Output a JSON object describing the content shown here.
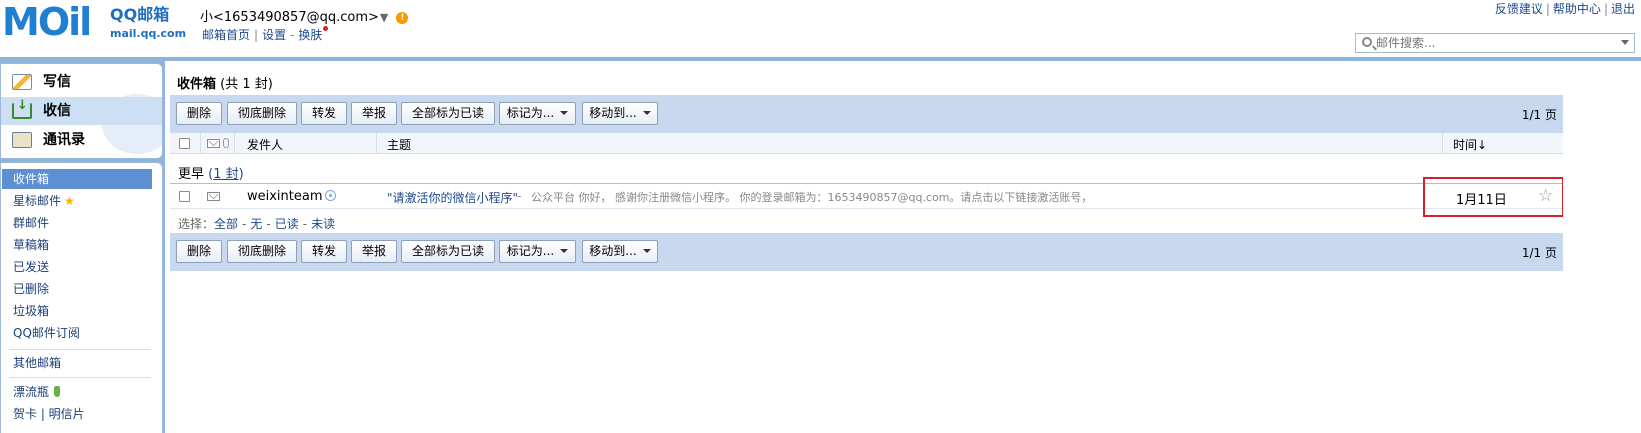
{
  "header": {
    "logo_text_moil": "MOil",
    "logo_text_cn": "QQ邮箱",
    "logo_text_url": "mail.qq.com",
    "account_label": "小<1653490857@qq.com>",
    "account_caret": "▼",
    "warning_glyph": "!",
    "links": [
      "邮箱首页",
      "设置",
      "换肤"
    ],
    "top_links": [
      "反馈建议",
      "帮助中心",
      "退出"
    ],
    "search_placeholder": "邮件搜索..."
  },
  "sidebar": {
    "quick": [
      {
        "label": "写信",
        "icon": "compose-icon"
      },
      {
        "label": "收信",
        "icon": "inbox-icon",
        "active": true
      },
      {
        "label": "通讯录",
        "icon": "contacts-icon"
      }
    ],
    "folders": [
      "收件箱",
      "星标邮件",
      "群邮件",
      "草稿箱",
      "已发送",
      "已删除",
      "垃圾箱",
      "QQ邮件订阅",
      "其他邮箱",
      "漂流瓶",
      "贺卡 | 明信片"
    ],
    "star_glyph": "★"
  },
  "main": {
    "title": "收件箱",
    "title_count": "(共 1 封)",
    "toolbar": {
      "delete": "删除",
      "delete_permanent": "彻底删除",
      "forward": "转发",
      "report": "举报",
      "mark_all_read": "全部标为已读",
      "mark_as": "标记为...",
      "move_to": "移动到..."
    },
    "page_info": "1/1 页",
    "columns": {
      "sender": "发件人",
      "subject": "主题",
      "time": "时间↓"
    },
    "group": {
      "label": "更早",
      "count": "1 封"
    },
    "email": {
      "sender": "weixinteam",
      "subject": "\"请激活你的微信小程序\"",
      "dash": "-",
      "preview": "公众平台 你好， 感谢你注册微信小程序。 你的登录邮箱为：1653490857@qq.com。请点击以下链接激活账号，",
      "date": "1月11日",
      "star": "☆"
    },
    "select": {
      "prefix": "选择：",
      "options": [
        "全部",
        "无",
        "已读",
        "未读"
      ]
    }
  },
  "colors": {
    "accent_blue": "#1f7fd0",
    "toolbar_bg": "#c8d9ef",
    "active_folder": "#5d8fd2",
    "highlight_red": "#d8222a"
  }
}
